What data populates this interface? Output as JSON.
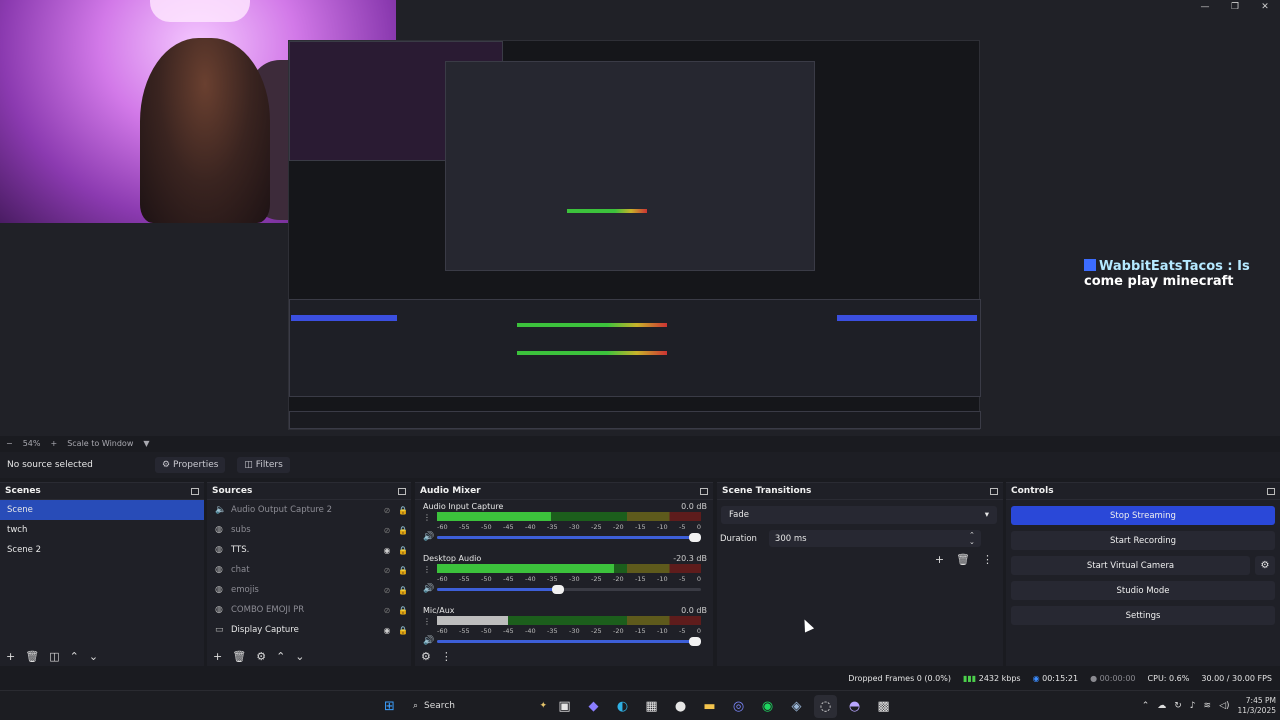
{
  "window": {
    "minimize": "—",
    "maximize": "❐",
    "close": "✕"
  },
  "preview": {
    "chat": {
      "name": "WabbitEatsTacos",
      "message": ": Is come play minecraft",
      "line1": "WabbitEatsTacos : Is",
      "line2": "come play minecraft"
    }
  },
  "zoom": {
    "level": "54%",
    "mode": "Scale to Window"
  },
  "source_bar": {
    "no_source": "No source selected",
    "properties": "Properties",
    "filters": "Filters"
  },
  "scenes": {
    "title": "Scenes",
    "items": [
      {
        "label": "Scene",
        "active": true
      },
      {
        "label": "twch",
        "active": false
      },
      {
        "label": "Scene 2",
        "active": false
      }
    ]
  },
  "sources": {
    "title": "Sources",
    "items": [
      {
        "label": "Audio Output Capture 2",
        "icon": "speaker-icon",
        "glyph": "🔈",
        "visible": false
      },
      {
        "label": "subs",
        "icon": "globe-icon",
        "glyph": "◍",
        "visible": false
      },
      {
        "label": "TTS.",
        "icon": "globe-icon",
        "glyph": "◍",
        "visible": true
      },
      {
        "label": "chat",
        "icon": "globe-icon",
        "glyph": "◍",
        "visible": false
      },
      {
        "label": "emojis",
        "icon": "globe-icon",
        "glyph": "◍",
        "visible": false
      },
      {
        "label": "COMBO EMOJI PR",
        "icon": "globe-icon",
        "glyph": "◍",
        "visible": false
      },
      {
        "label": "Display Capture",
        "icon": "monitor-icon",
        "glyph": "▭",
        "visible": true
      }
    ]
  },
  "mixer": {
    "title": "Audio Mixer",
    "ticks": [
      "-60",
      "-55",
      "-50",
      "-45",
      "-40",
      "-35",
      "-30",
      "-25",
      "-20",
      "-15",
      "-10",
      "-5",
      "0"
    ],
    "channels": [
      {
        "name": "Audio Input Capture",
        "db": "0.0 dB",
        "level": 0.43,
        "volume": 1.0,
        "muted": false
      },
      {
        "name": "Desktop Audio",
        "db": "-20.3 dB",
        "level": 0.67,
        "volume": 0.48,
        "muted": false
      },
      {
        "name": "Mic/Aux",
        "db": "0.0 dB",
        "level": 0.27,
        "volume": 1.0,
        "muted": false
      }
    ]
  },
  "transitions": {
    "title": "Scene Transitions",
    "selected": "Fade",
    "duration_label": "Duration",
    "duration_value": "300 ms"
  },
  "controls": {
    "title": "Controls",
    "stop_streaming": "Stop Streaming",
    "start_recording": "Start Recording",
    "start_virtual_camera": "Start Virtual Camera",
    "studio_mode": "Studio Mode",
    "settings": "Settings"
  },
  "status": {
    "dropped_frames": "Dropped Frames 0 (0.0%)",
    "bitrate": "2432 kbps",
    "stream_time": "00:15:21",
    "record_time": "00:00:00",
    "cpu": "CPU: 0.6%",
    "fps": "30.00 / 30.00 FPS"
  },
  "taskbar": {
    "search_label": "Search",
    "time": "7:45 PM",
    "date": "11/3/2025"
  },
  "colors": {
    "accent": "#2a48d8",
    "scene_active": "#284cb8",
    "meter_green": "#3cc23c",
    "meter_yellow": "#c8b22a",
    "meter_red": "#c33333"
  }
}
